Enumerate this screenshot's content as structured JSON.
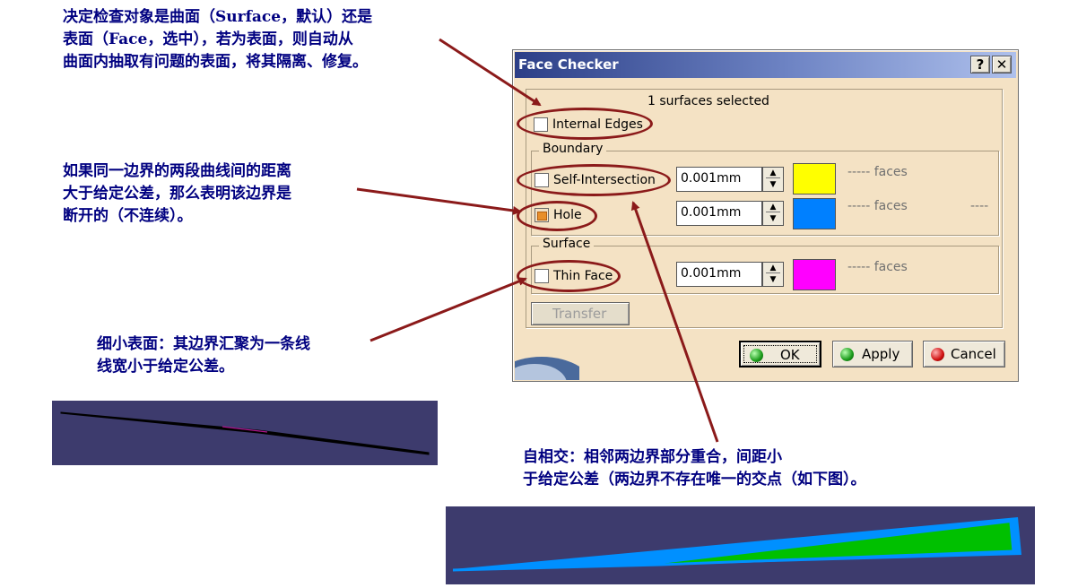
{
  "annotations": {
    "top": [
      "决定检查对象是曲面（Surface，默认）还是",
      "表面（Face，选中），若为表面，则自动从",
      "曲面内抽取有问题的表面，将其隔离、修复。"
    ],
    "middle": [
      "如果同一边界的两段曲线间的距离",
      "大于给定公差，那么表明该边界是",
      "断开的（不连续）。"
    ],
    "thin": [
      "细小表面：其边界汇聚为一条线",
      "线宽小于给定公差。"
    ],
    "self": [
      "自相交：相邻两边界部分重合，间距小",
      "于给定公差（两边界不存在唯一的交点（如下图）。"
    ]
  },
  "dialog": {
    "title": "Face Checker",
    "help_button": "?",
    "close_button": "✕",
    "selection_text": "1 surfaces selected",
    "internal_edges_label": "Internal Edges",
    "boundary_group": "Boundary",
    "self_intersection_label": "Self-Intersection",
    "self_intersection_value": "0.001mm",
    "self_intersection_faces": "----- faces",
    "hole_label": "Hole",
    "hole_value": "0.001mm",
    "hole_faces": "----- faces",
    "hole_faces_extra": "----",
    "surface_group": "Surface",
    "thin_face_label": "Thin Face",
    "thin_face_value": "0.001mm",
    "thin_face_faces": "----- faces",
    "transfer_button": "Transfer",
    "ok_button": "OK",
    "apply_button": "Apply",
    "cancel_button": "Cancel"
  },
  "colors": {
    "self_intersection_swatch": "#ffff00",
    "hole_swatch": "#0080ff",
    "thin_face_swatch": "#ff00ff",
    "annotation_text": "#000080",
    "callout": "#8b1a1a"
  },
  "checkbox_state": {
    "internal_edges": false,
    "self_intersection": false,
    "hole": true,
    "thin_face": false
  }
}
